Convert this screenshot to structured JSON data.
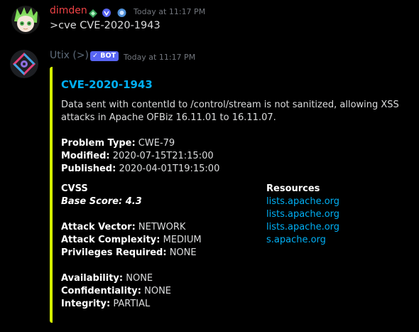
{
  "colors": {
    "user_name": "#ed4245",
    "bot_name": "#5d6b7a",
    "accent_bar": "#d4f100",
    "link": "#00aff4",
    "bot_tag": "#5865f2"
  },
  "message_user": {
    "username": "dimden",
    "timestamp": "Today at 11:17 PM",
    "text": ">cve CVE-2020-1943",
    "badges": [
      "nitro-badge-icon",
      "hypesquad-badge-icon",
      "boost-badge-icon"
    ]
  },
  "message_bot": {
    "username": "Utix (>)",
    "bot_tag": "✓ BOT",
    "timestamp": "Today at 11:17 PM"
  },
  "embed": {
    "title": "CVE-2020-1943",
    "description": "Data sent with contentId to /control/stream is not sanitized, allowing XSS attacks in Apache OFBiz 16.11.01 to 16.11.07.",
    "problem_type_label": "Problem Type:",
    "problem_type": "CWE-79",
    "modified_label": "Modified:",
    "modified": "2020-07-15T21:15:00",
    "published_label": "Published:",
    "published": "2020-04-01T19:15:00",
    "cvss_heading": "CVSS",
    "base_score": "Base Score: 4.3",
    "attack_vector_label": "Attack Vector:",
    "attack_vector": "NETWORK",
    "attack_complexity_label": "Attack Complexity:",
    "attack_complexity": "MEDIUM",
    "privileges_label": "Privileges Required:",
    "privileges": "NONE",
    "availability_label": "Availability:",
    "availability": "NONE",
    "confidentiality_label": "Confidentiality:",
    "confidentiality": "NONE",
    "integrity_label": "Integrity:",
    "integrity": "PARTIAL",
    "resources_heading": "Resources",
    "resources": [
      "lists.apache.org",
      "lists.apache.org",
      "lists.apache.org",
      "s.apache.org"
    ]
  }
}
